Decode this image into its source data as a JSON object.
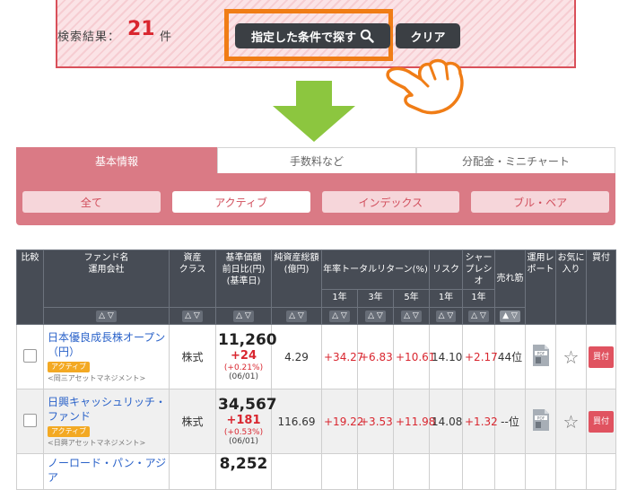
{
  "search": {
    "result_label": "検索結果：",
    "result_count": "21",
    "result_unit": "件",
    "search_button": "指定した条件で探す",
    "clear_button": "クリア"
  },
  "tabs": [
    {
      "label": "基本情報",
      "active": true
    },
    {
      "label": "手数料など",
      "active": false
    },
    {
      "label": "分配金・ミニチャート",
      "active": false
    }
  ],
  "filters": [
    {
      "label": "全て",
      "active": false
    },
    {
      "label": "アクティブ",
      "active": true
    },
    {
      "label": "インデックス",
      "active": false
    },
    {
      "label": "ブル・ベア",
      "active": false
    }
  ],
  "table": {
    "headers": {
      "compare": "比較",
      "fund_name": "ファンド名",
      "company": "運用会社",
      "asset_class": "資産\nクラス",
      "nav": "基準価額\n前日比(円)\n(基準日)",
      "net_assets": "純資産総額\n(億円)",
      "total_return": "年率トータルリターン(%)",
      "risk": "リスク",
      "sharpe": "シャー\nプレシ\nオ",
      "rank": "売れ筋",
      "report": "運用レ\nポート",
      "favorite": "お気に\n入り",
      "buy": "買付",
      "y1": "1年",
      "y3": "3年",
      "y5": "5年",
      "risk_y1": "1年",
      "sharpe_y1": "1年",
      "sort": "△ ▽",
      "sort_rank": "▲ ▽"
    },
    "rows": [
      {
        "name": "日本優良成長株オープン（円）",
        "badge": "アクティブ",
        "company": "<岡三アセットマネジメント>",
        "asset_class": "株式",
        "price": "11,260",
        "change": "+24",
        "change_pct": "(+0.21%)",
        "date": "(06/01)",
        "net_assets": "4.29",
        "r1": "+34.27",
        "r3": "+6.83",
        "r5": "+10.61",
        "risk": "14.10",
        "sharpe": "+2.17",
        "rank": "44位",
        "buy": "買付"
      },
      {
        "name": "日興キャッシュリッチ・ファンド",
        "badge": "アクティブ",
        "company": "<日興アセットマネジメント>",
        "asset_class": "株式",
        "price": "34,567",
        "change": "+181",
        "change_pct": "(+0.53%)",
        "date": "(06/01)",
        "net_assets": "116.69",
        "r1": "+19.22",
        "r3": "+3.53",
        "r5": "+11.98",
        "risk": "14.08",
        "sharpe": "+1.32",
        "rank": "--位",
        "buy": "買付"
      },
      {
        "name": "ノーロード・パン・アジア",
        "price": "8,252"
      }
    ]
  },
  "colors": {
    "accent": "#da7a85",
    "highlight": "#f07d16",
    "arrow": "#8cc63f",
    "positive": "#d9262f",
    "header_bg": "#474c55"
  }
}
